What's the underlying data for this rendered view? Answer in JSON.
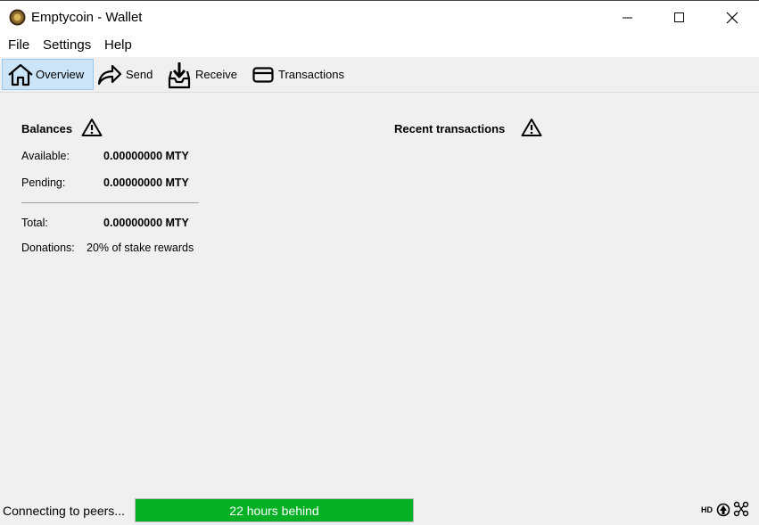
{
  "window": {
    "title": "Emptycoin - Wallet",
    "controls": [
      "minimize-icon",
      "maximize-icon",
      "close-icon"
    ]
  },
  "menu": {
    "items": [
      "File",
      "Settings",
      "Help"
    ]
  },
  "toolbar": {
    "tabs": [
      {
        "label": "Overview",
        "icon": "home-icon",
        "active": true
      },
      {
        "label": "Send",
        "icon": "send-arrow-icon",
        "active": false
      },
      {
        "label": "Receive",
        "icon": "receive-tray-icon",
        "active": false
      },
      {
        "label": "Transactions",
        "icon": "card-icon",
        "active": false
      }
    ],
    "active_color": "#cce4f7"
  },
  "balances": {
    "heading": "Balances",
    "available_label": "Available:",
    "available_value": "0.00000000 MTY",
    "pending_label": "Pending:",
    "pending_value": "0.00000000 MTY",
    "total_label": "Total:",
    "total_value": "0.00000000 MTY",
    "donations_label": "Donations:",
    "donations_value": "20% of stake rewards"
  },
  "recent": {
    "heading": "Recent transactions"
  },
  "status": {
    "text": "Connecting to peers...",
    "progress_label": "22 hours behind",
    "progress_fraction": 1.0,
    "progress_color": "#06b025",
    "hd_label": "HD"
  }
}
